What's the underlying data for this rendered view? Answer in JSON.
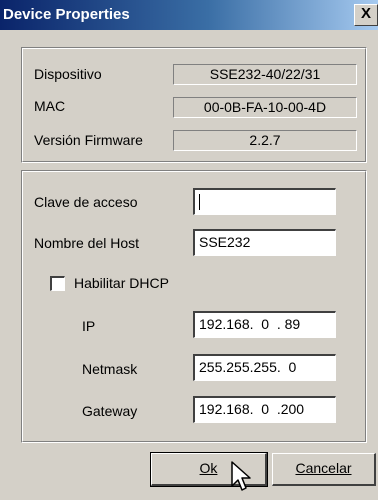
{
  "window": {
    "title": "Device Properties",
    "close_glyph": "X"
  },
  "device_info": {
    "device_label": "Dispositivo",
    "device_value": "SSE232-40/22/31",
    "mac_label": "MAC",
    "mac_value": "00-0B-FA-10-00-4D",
    "firmware_label": "Versión Firmware",
    "firmware_value": "2.2.7"
  },
  "settings": {
    "password_label": "Clave de acceso",
    "password_value": "",
    "hostname_label": "Nombre del Host",
    "hostname_value": "SSE232",
    "dhcp_label": "Habilitar DHCP",
    "ip_label": "IP",
    "ip_value": "192.168.  0  . 89",
    "netmask_label": "Netmask",
    "netmask_value": "255.255.255.  0",
    "gateway_label": "Gateway",
    "gateway_value": "192.168.  0  .200"
  },
  "buttons": {
    "ok_label": "Ok",
    "cancel_label": "Cancelar"
  },
  "colors": {
    "dialog_bg": "#d4d0c8",
    "title_start": "#0a246a",
    "title_end": "#a6caf0"
  }
}
